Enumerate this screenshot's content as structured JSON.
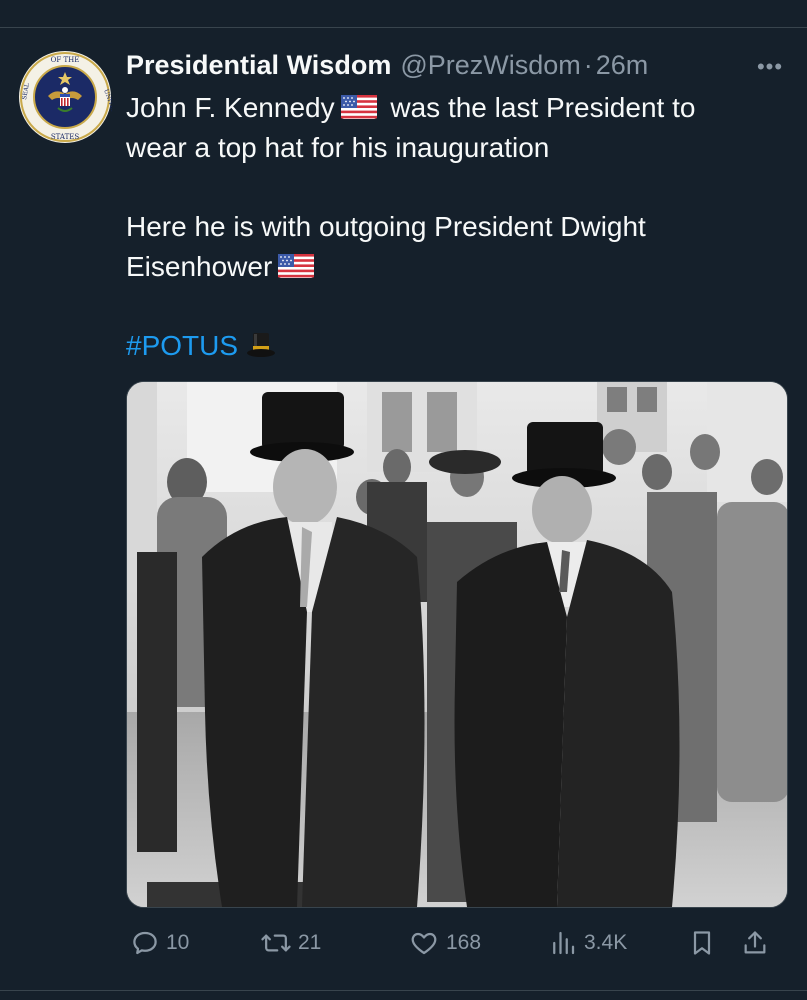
{
  "tweet": {
    "display_name": "Presidential Wisdom",
    "handle": "@PrezWisdom",
    "separator": "·",
    "time": "26m",
    "more_label": "•••",
    "text": {
      "line1_a": "John F. Kennedy",
      "line1_b": "was the last President to",
      "line2": "wear a top hat for his inauguration",
      "line3": "Here he is with outgoing President Dwight",
      "line4": "Eisenhower",
      "hashtag": "#POTUS"
    },
    "avatar_icon": "presidential-seal-icon",
    "image_alt": "black-and-white photo of two men in top hats and overcoats with a crowd behind"
  },
  "actions": {
    "replies": "10",
    "retweets": "21",
    "likes": "168",
    "views": "3.4K"
  },
  "colors": {
    "background": "#15202b",
    "text": "#f7f9f9",
    "muted": "#8b98a5",
    "accent": "#1d9bf0",
    "divider": "#38444d"
  }
}
